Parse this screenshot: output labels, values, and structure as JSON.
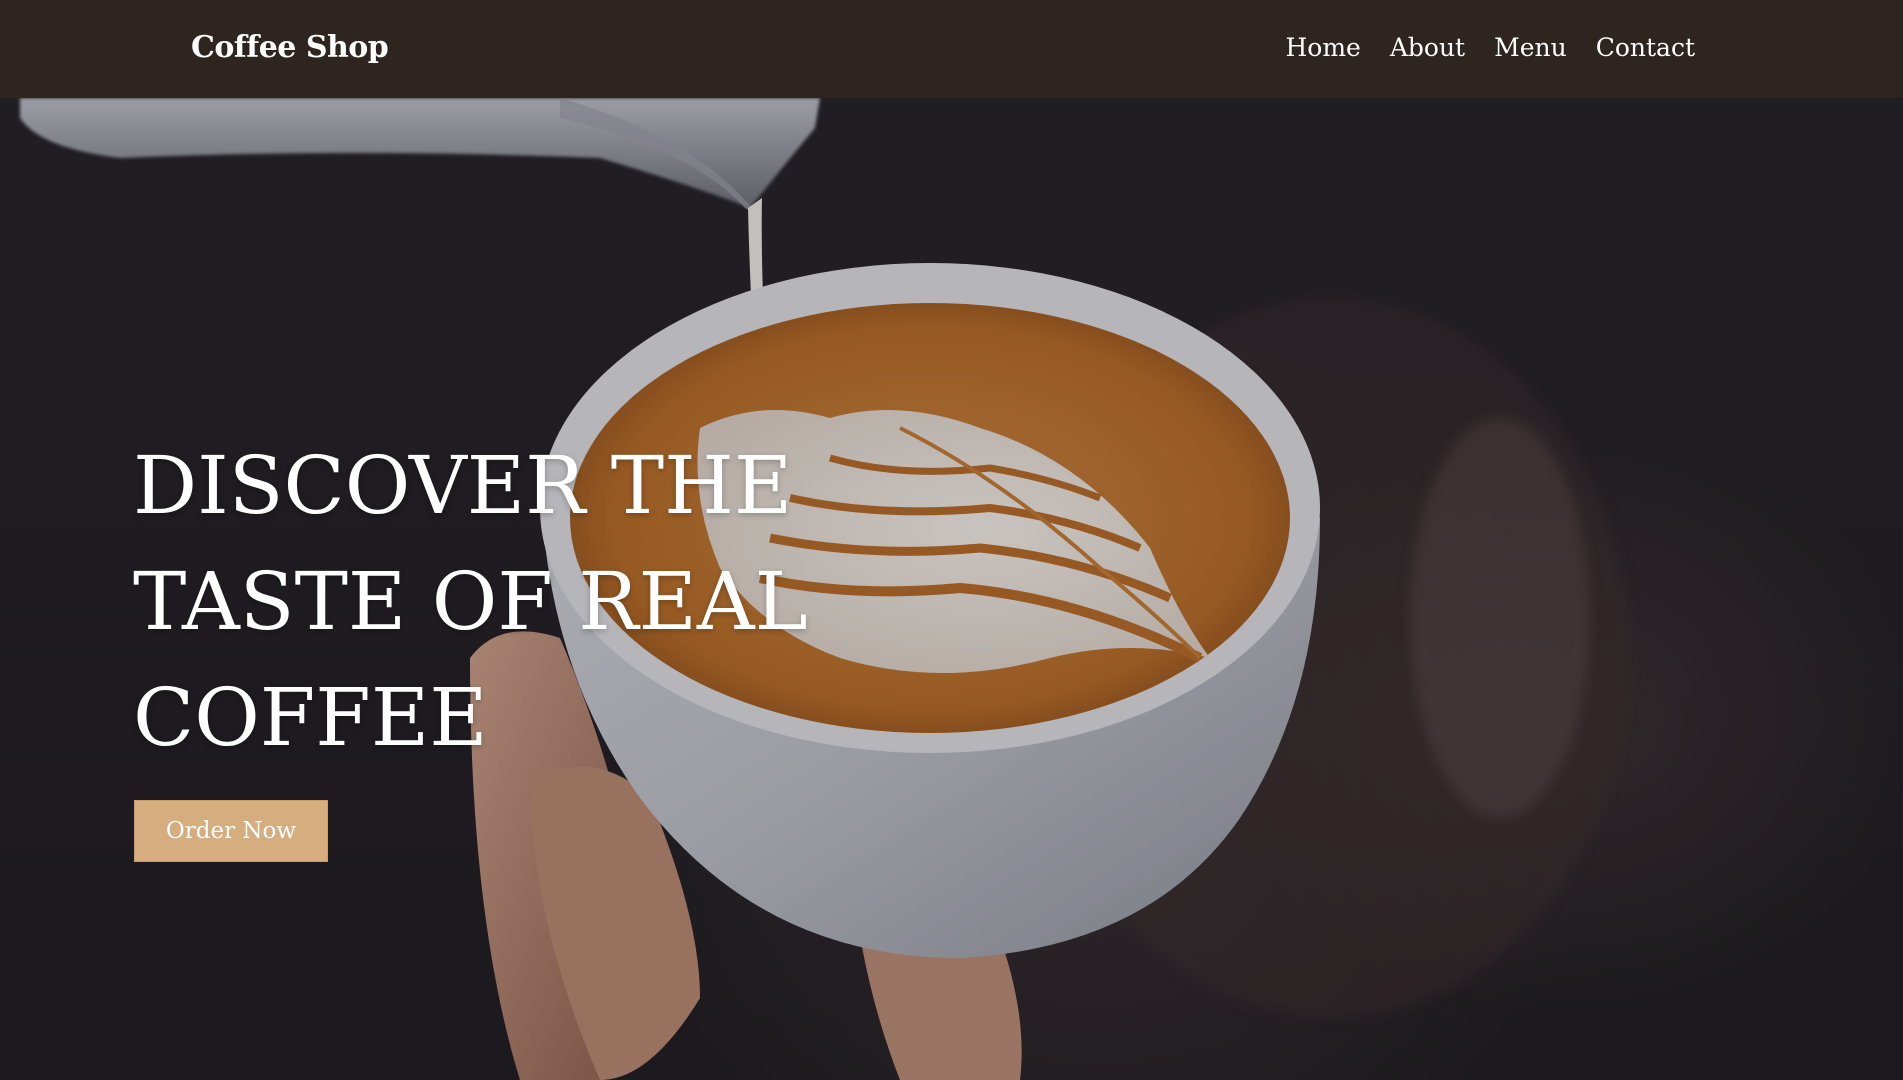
{
  "navbar": {
    "brand": "Coffee Shop",
    "links": [
      {
        "label": "Home"
      },
      {
        "label": "About"
      },
      {
        "label": "Menu"
      },
      {
        "label": "Contact"
      }
    ],
    "background": "#2e2420"
  },
  "hero": {
    "title_lines": [
      "DISCOVER THE",
      "TASTE OF REAL",
      "COFFEE"
    ],
    "cta_label": "Order Now",
    "cta_color": "#d6ad7f",
    "image_subject": "latte-art-photo"
  }
}
